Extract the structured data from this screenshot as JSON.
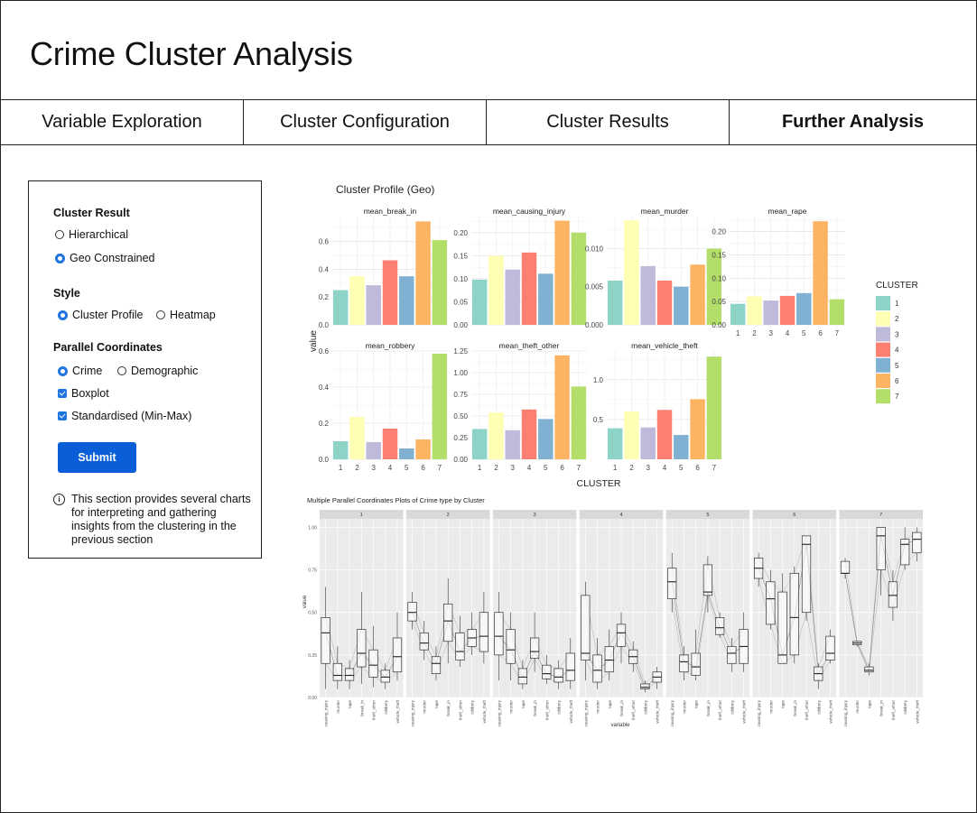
{
  "page": {
    "title": "Crime Cluster Analysis"
  },
  "tabs": [
    {
      "label": "Variable Exploration",
      "active": false
    },
    {
      "label": "Cluster Configuration",
      "active": false
    },
    {
      "label": "Cluster Results",
      "active": false
    },
    {
      "label": "Further Analysis",
      "active": true
    }
  ],
  "sidebar": {
    "cluster_result": {
      "heading": "Cluster Result",
      "options": [
        "Hierarchical",
        "Geo Constrained"
      ],
      "selected": "Geo Constrained"
    },
    "style": {
      "heading": "Style",
      "options": [
        "Cluster Profile",
        "Heatmap"
      ],
      "selected": "Cluster Profile"
    },
    "parallel": {
      "heading": "Parallel Coordinates",
      "options": [
        "Crime",
        "Demographic"
      ],
      "selected": "Crime",
      "checkboxes": [
        {
          "label": "Boxplot",
          "checked": true
        },
        {
          "label": "Standardised (Min-Max)",
          "checked": true
        }
      ]
    },
    "submit_label": "Submit",
    "info_icon": "info-icon",
    "info_text": "This section provides several charts for interpreting and gathering insights from the clustering in the previous section"
  },
  "chart_data": [
    {
      "type": "bar",
      "title": "Cluster Profile (Geo)",
      "xlabel": "CLUSTER",
      "ylabel": "value",
      "categories": [
        "1",
        "2",
        "3",
        "4",
        "5",
        "6",
        "7"
      ],
      "legend": {
        "title": "CLUSTER",
        "entries": [
          "1",
          "2",
          "3",
          "4",
          "5",
          "6",
          "7"
        ],
        "position": "right"
      },
      "colors": [
        "#8dd3c7",
        "#ffffb3",
        "#bebada",
        "#fb8072",
        "#80b1d3",
        "#fdb462",
        "#b3de69"
      ],
      "facets": [
        {
          "name": "mean_break_in",
          "values": [
            0.25,
            0.35,
            0.285,
            0.465,
            0.35,
            0.745,
            0.61
          ],
          "ylim": [
            0,
            0.78
          ],
          "ticks": [
            "0.0",
            "0.2",
            "0.4",
            "0.6"
          ]
        },
        {
          "name": "mean_causing_injury",
          "values": [
            0.098,
            0.15,
            0.12,
            0.157,
            0.111,
            0.226,
            0.2
          ],
          "ylim": [
            0,
            0.235
          ],
          "ticks": [
            "0.00",
            "0.05",
            "0.10",
            "0.15",
            "0.20"
          ]
        },
        {
          "name": "mean_murder",
          "values": [
            0.0058,
            0.0137,
            0.0077,
            0.0058,
            0.005,
            0.0079,
            0.01
          ],
          "ylim": [
            0,
            0.0142
          ],
          "ticks": [
            "0.000",
            "0.005",
            "0.010"
          ]
        },
        {
          "name": "mean_rape",
          "values": [
            0.045,
            0.061,
            0.052,
            0.062,
            0.068,
            0.222,
            0.055
          ],
          "ylim": [
            0,
            0.232
          ],
          "ticks": [
            "0.00",
            "0.05",
            "0.10",
            "0.15",
            "0.20"
          ]
        },
        {
          "name": "mean_robbery",
          "values": [
            0.1,
            0.235,
            0.095,
            0.17,
            0.06,
            0.11,
            0.585
          ],
          "ylim": [
            0,
            0.6
          ],
          "ticks": [
            "0.0",
            "0.2",
            "0.4",
            "0.6"
          ]
        },
        {
          "name": "mean_theft_other",
          "values": [
            0.35,
            0.54,
            0.335,
            0.575,
            0.465,
            1.2,
            0.84
          ],
          "ylim": [
            0,
            1.25
          ],
          "ticks": [
            "0.00",
            "0.25",
            "0.50",
            "0.75",
            "1.00",
            "1.25"
          ]
        },
        {
          "name": "mean_vehicle_theft",
          "values": [
            0.39,
            0.6,
            0.4,
            0.62,
            0.305,
            0.755,
            1.29
          ],
          "ylim": [
            0,
            1.36
          ],
          "ticks": [
            "0.5",
            "1.0"
          ],
          "tick_values": [
            0.5,
            1.0
          ],
          "zero_tick": false
        }
      ]
    },
    {
      "type": "box",
      "title": "Multiple Parallel Coordinates Plots of Crime type by Cluster",
      "xlabel": "variable",
      "ylabel": "value",
      "ylim": [
        0,
        1.05
      ],
      "ticks": [
        "0.00",
        "0.25",
        "0.50",
        "0.75",
        "1.00"
      ],
      "variables": [
        "causing_injury",
        "murder",
        "rape",
        "break_in",
        "theft_other",
        "robbery",
        "vehicle_theft"
      ],
      "panels": [
        {
          "name": "1",
          "boxes": [
            [
              0.05,
              0.2,
              0.38,
              0.47,
              0.65
            ],
            [
              0.05,
              0.1,
              0.13,
              0.2,
              0.3
            ],
            [
              0.05,
              0.1,
              0.13,
              0.17,
              0.22
            ],
            [
              0.08,
              0.18,
              0.26,
              0.4,
              0.62
            ],
            [
              0.06,
              0.12,
              0.19,
              0.28,
              0.42
            ],
            [
              0.05,
              0.09,
              0.12,
              0.16,
              0.2
            ],
            [
              0.1,
              0.15,
              0.24,
              0.35,
              0.5
            ]
          ]
        },
        {
          "name": "2",
          "boxes": [
            [
              0.4,
              0.45,
              0.5,
              0.56,
              0.62
            ],
            [
              0.22,
              0.28,
              0.32,
              0.38,
              0.45
            ],
            [
              0.1,
              0.14,
              0.2,
              0.24,
              0.3
            ],
            [
              0.2,
              0.33,
              0.45,
              0.55,
              0.7
            ],
            [
              0.18,
              0.22,
              0.27,
              0.38,
              0.48
            ],
            [
              0.25,
              0.3,
              0.35,
              0.4,
              0.5
            ],
            [
              0.2,
              0.27,
              0.36,
              0.5,
              0.62
            ]
          ]
        },
        {
          "name": "3",
          "boxes": [
            [
              0.1,
              0.25,
              0.36,
              0.5,
              0.62
            ],
            [
              0.1,
              0.2,
              0.28,
              0.4,
              0.5
            ],
            [
              0.05,
              0.08,
              0.12,
              0.17,
              0.22
            ],
            [
              0.15,
              0.23,
              0.27,
              0.35,
              0.5
            ],
            [
              0.08,
              0.11,
              0.14,
              0.19,
              0.25
            ],
            [
              0.05,
              0.09,
              0.12,
              0.17,
              0.22
            ],
            [
              0.05,
              0.1,
              0.16,
              0.26,
              0.35
            ]
          ]
        },
        {
          "name": "4",
          "boxes": [
            [
              0.1,
              0.22,
              0.26,
              0.6,
              0.68
            ],
            [
              0.05,
              0.09,
              0.16,
              0.25,
              0.35
            ],
            [
              0.1,
              0.15,
              0.22,
              0.3,
              0.4
            ],
            [
              0.2,
              0.3,
              0.38,
              0.43,
              0.5
            ],
            [
              0.15,
              0.2,
              0.24,
              0.28,
              0.33
            ],
            [
              0.03,
              0.05,
              0.06,
              0.08,
              0.1
            ],
            [
              0.05,
              0.09,
              0.12,
              0.15,
              0.18
            ]
          ]
        },
        {
          "name": "5",
          "boxes": [
            [
              0.5,
              0.58,
              0.68,
              0.76,
              0.85
            ],
            [
              0.1,
              0.15,
              0.21,
              0.25,
              0.3
            ],
            [
              0.1,
              0.13,
              0.18,
              0.26,
              0.4
            ],
            [
              0.5,
              0.6,
              0.62,
              0.78,
              0.83
            ],
            [
              0.35,
              0.37,
              0.41,
              0.47,
              0.5
            ],
            [
              0.15,
              0.2,
              0.26,
              0.3,
              0.35
            ],
            [
              0.15,
              0.2,
              0.3,
              0.4,
              0.5
            ]
          ]
        },
        {
          "name": "6",
          "boxes": [
            [
              0.65,
              0.7,
              0.76,
              0.82,
              0.85
            ],
            [
              0.4,
              0.43,
              0.58,
              0.68,
              0.75
            ],
            [
              0.2,
              0.2,
              0.25,
              0.62,
              0.73
            ],
            [
              0.2,
              0.25,
              0.47,
              0.73,
              0.77
            ],
            [
              0.45,
              0.5,
              0.9,
              0.95,
              0.95
            ],
            [
              0.05,
              0.1,
              0.14,
              0.18,
              0.2
            ],
            [
              0.2,
              0.22,
              0.26,
              0.36,
              0.4
            ]
          ]
        },
        {
          "name": "7",
          "boxes": [
            [
              0.7,
              0.73,
              0.73,
              0.8,
              0.82
            ],
            [
              0.3,
              0.31,
              0.32,
              0.33,
              0.33
            ],
            [
              0.13,
              0.15,
              0.16,
              0.18,
              0.2
            ],
            [
              0.6,
              0.75,
              0.95,
              1.0,
              1.0
            ],
            [
              0.45,
              0.53,
              0.6,
              0.68,
              0.75
            ],
            [
              0.75,
              0.78,
              0.9,
              0.93,
              1.0
            ],
            [
              0.8,
              0.85,
              0.93,
              0.97,
              1.0
            ]
          ]
        }
      ]
    }
  ]
}
